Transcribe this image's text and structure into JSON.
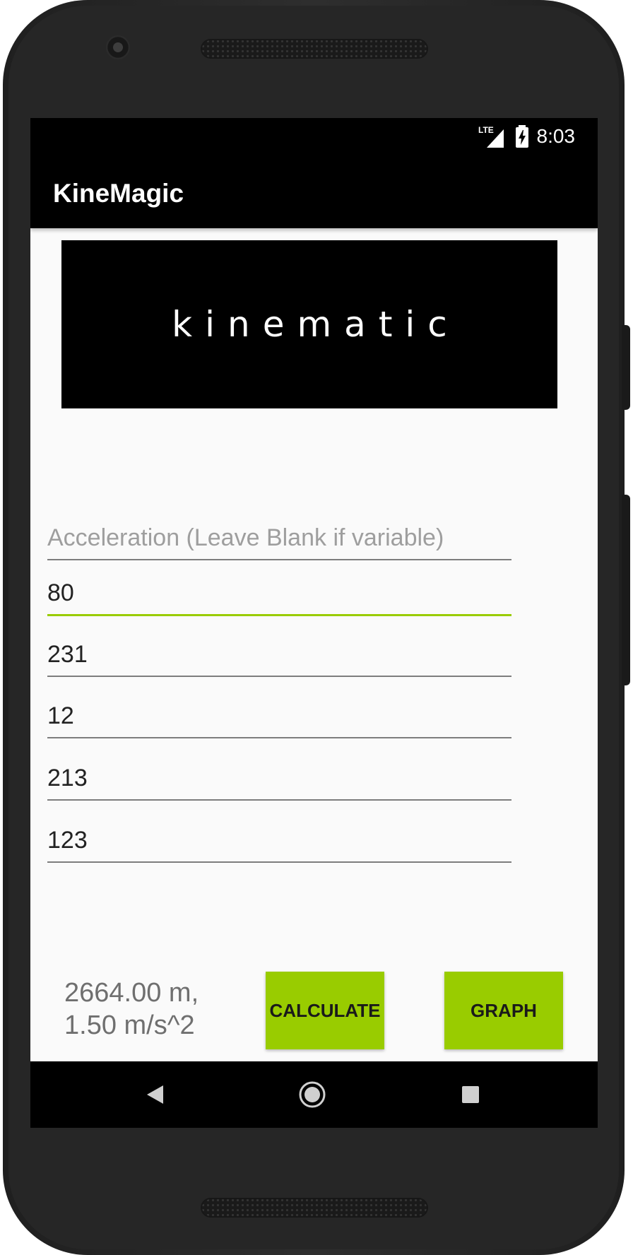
{
  "status_bar": {
    "network": "LTE",
    "time": "8:03"
  },
  "app_bar": {
    "title": "KineMagic"
  },
  "banner": {
    "text": "kinematic"
  },
  "form": {
    "acceleration": {
      "value": "",
      "placeholder": "Acceleration (Leave Blank if variable)"
    },
    "field_2": {
      "value": "80"
    },
    "field_3": {
      "value": "231"
    },
    "field_4": {
      "value": "12"
    },
    "field_5": {
      "value": "213"
    },
    "field_6": {
      "value": "123"
    }
  },
  "result": {
    "line1": "2664.00 m,",
    "line2": "1.50 m/s^2"
  },
  "buttons": {
    "calculate": "CALCULATE",
    "graph": "GRAPH"
  },
  "colors": {
    "accent": "#99cc00",
    "app_bar": "#000000",
    "background": "#fafafa"
  },
  "nav": {
    "icons": [
      "back-icon",
      "home-icon",
      "recents-icon"
    ]
  }
}
